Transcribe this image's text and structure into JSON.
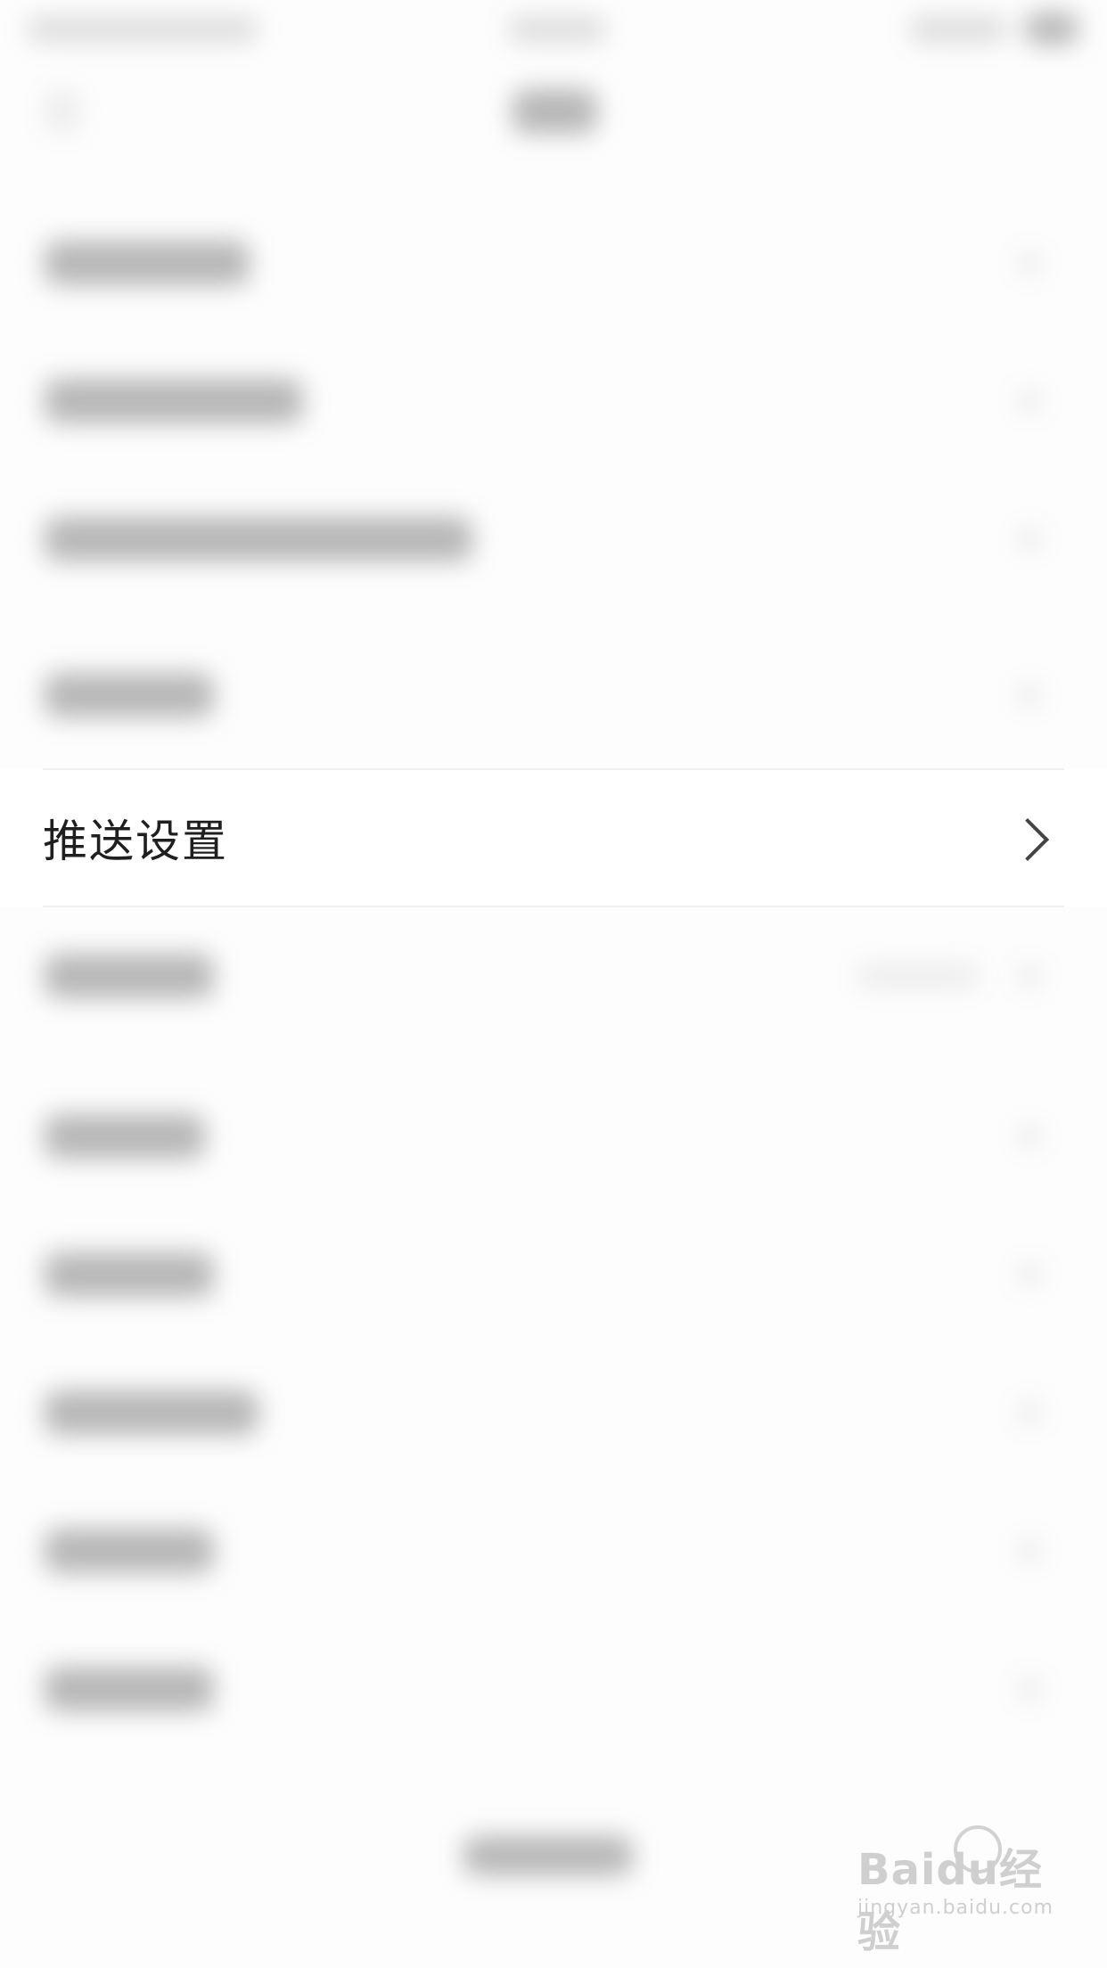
{
  "list": {
    "highlighted_item": {
      "label": "推送设置"
    }
  },
  "watermark": {
    "logo": "Baidu经验",
    "url": "jingyan.baidu.com"
  }
}
